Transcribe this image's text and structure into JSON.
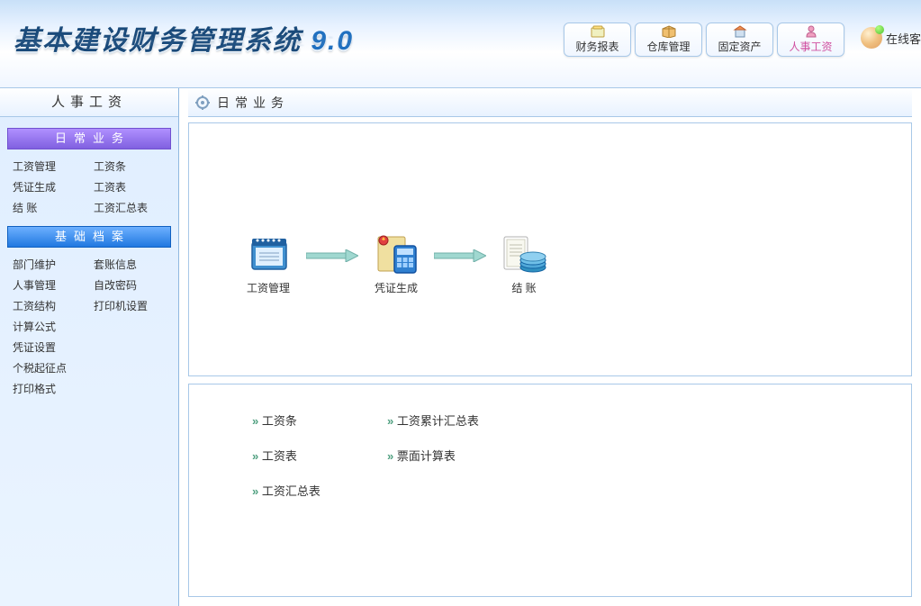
{
  "header": {
    "title_main": "基本建设财务管理系统",
    "title_version": "9.0",
    "nav": [
      {
        "label": "财务报表",
        "active": false
      },
      {
        "label": "仓库管理",
        "active": false
      },
      {
        "label": "固定资产",
        "active": false
      },
      {
        "label": "人事工资",
        "active": true
      }
    ],
    "online_label": "在线客"
  },
  "sidebar": {
    "title": "人事工资",
    "sections": [
      {
        "heading": "日常业务",
        "style": "daily",
        "items": [
          "工资管理",
          "工资条",
          "凭证生成",
          "工资表",
          "结 账",
          "工资汇总表"
        ]
      },
      {
        "heading": "基础档案",
        "style": "basic",
        "items": [
          "部门维护",
          "套账信息",
          "人事管理",
          "自改密码",
          "工资结构",
          "打印机设置",
          "计算公式",
          "",
          "凭证设置",
          "",
          "个税起征点",
          "",
          "打印格式",
          ""
        ]
      }
    ]
  },
  "main": {
    "title": "日常业务",
    "workflow": [
      {
        "label": "工资管理",
        "icon": "notebook"
      },
      {
        "label": "凭证生成",
        "icon": "calculator"
      },
      {
        "label": "结 账",
        "icon": "ledger"
      }
    ],
    "reports": [
      "工资条",
      "工资累计汇总表",
      "工资表",
      "票面计算表",
      "工资汇总表",
      ""
    ]
  }
}
